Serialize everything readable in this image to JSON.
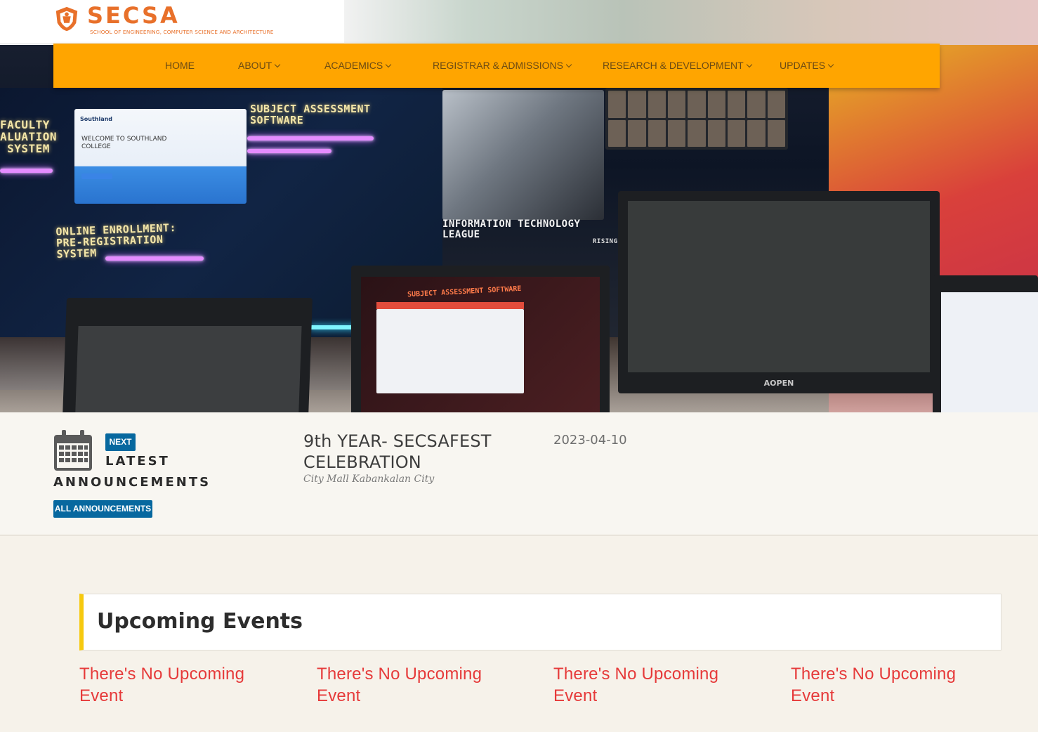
{
  "site": {
    "logo_title": "SECSA",
    "logo_subtitle": "SCHOOL OF ENGINEERING, COMPUTER SCIENCE AND ARCHITECTURE",
    "brand_color": "#e8702a"
  },
  "nav": {
    "bg_color": "#ffa500",
    "items": [
      {
        "label": "HOME",
        "dropdown": false
      },
      {
        "label": "ABOUT",
        "dropdown": true
      },
      {
        "label": "ACADEMICS",
        "dropdown": true
      },
      {
        "label": "REGISTRAR & ADMISSIONS",
        "dropdown": true
      },
      {
        "label": "RESEARCH & DEVELOPMENT",
        "dropdown": true
      },
      {
        "label": "UPDATES",
        "dropdown": true
      }
    ]
  },
  "hero": {
    "neon_labels": {
      "faculty": "FACULTY\nALUATION\n SYSTEM",
      "subject": "SUBJECT ASSESSMENT\nSOFTWARE",
      "enrollment": "ONLINE ENROLLMENT:\nPRE-REGISTRATION\nSYSTEM",
      "it_league": "INFORMATION TECHNOLOGY\nLEAGUE",
      "rising": "RISING"
    },
    "screen_enroll": {
      "brand": "Southland",
      "welcome": "WELCOME TO SOUTHLAND\nCOLLEGE"
    },
    "laptop_title": "SUBJECT ASSESSMENT SOFTWARE",
    "monitor_brand": "AOPEN"
  },
  "announcement": {
    "icon": "calendar-icon",
    "next_label": "NEXT",
    "heading_line1": "LATEST",
    "heading_line2": "ANNOUNCEMENTS",
    "all_button": "ALL ANNOUNCEMENTS",
    "title": "9th YEAR- SECSAFEST CELEBRATION",
    "location": "City Mall Kabankalan City",
    "date": "2023-04-10",
    "accent_color": "#07689f"
  },
  "events": {
    "title": "Upcoming Events",
    "accent_color": "#f6c90e",
    "items": [
      {
        "text": "There's No Upcoming Event"
      },
      {
        "text": "There's No Upcoming Event"
      },
      {
        "text": "There's No Upcoming Event"
      },
      {
        "text": "There's No Upcoming Event"
      }
    ],
    "empty_color": "#e63a3a"
  }
}
